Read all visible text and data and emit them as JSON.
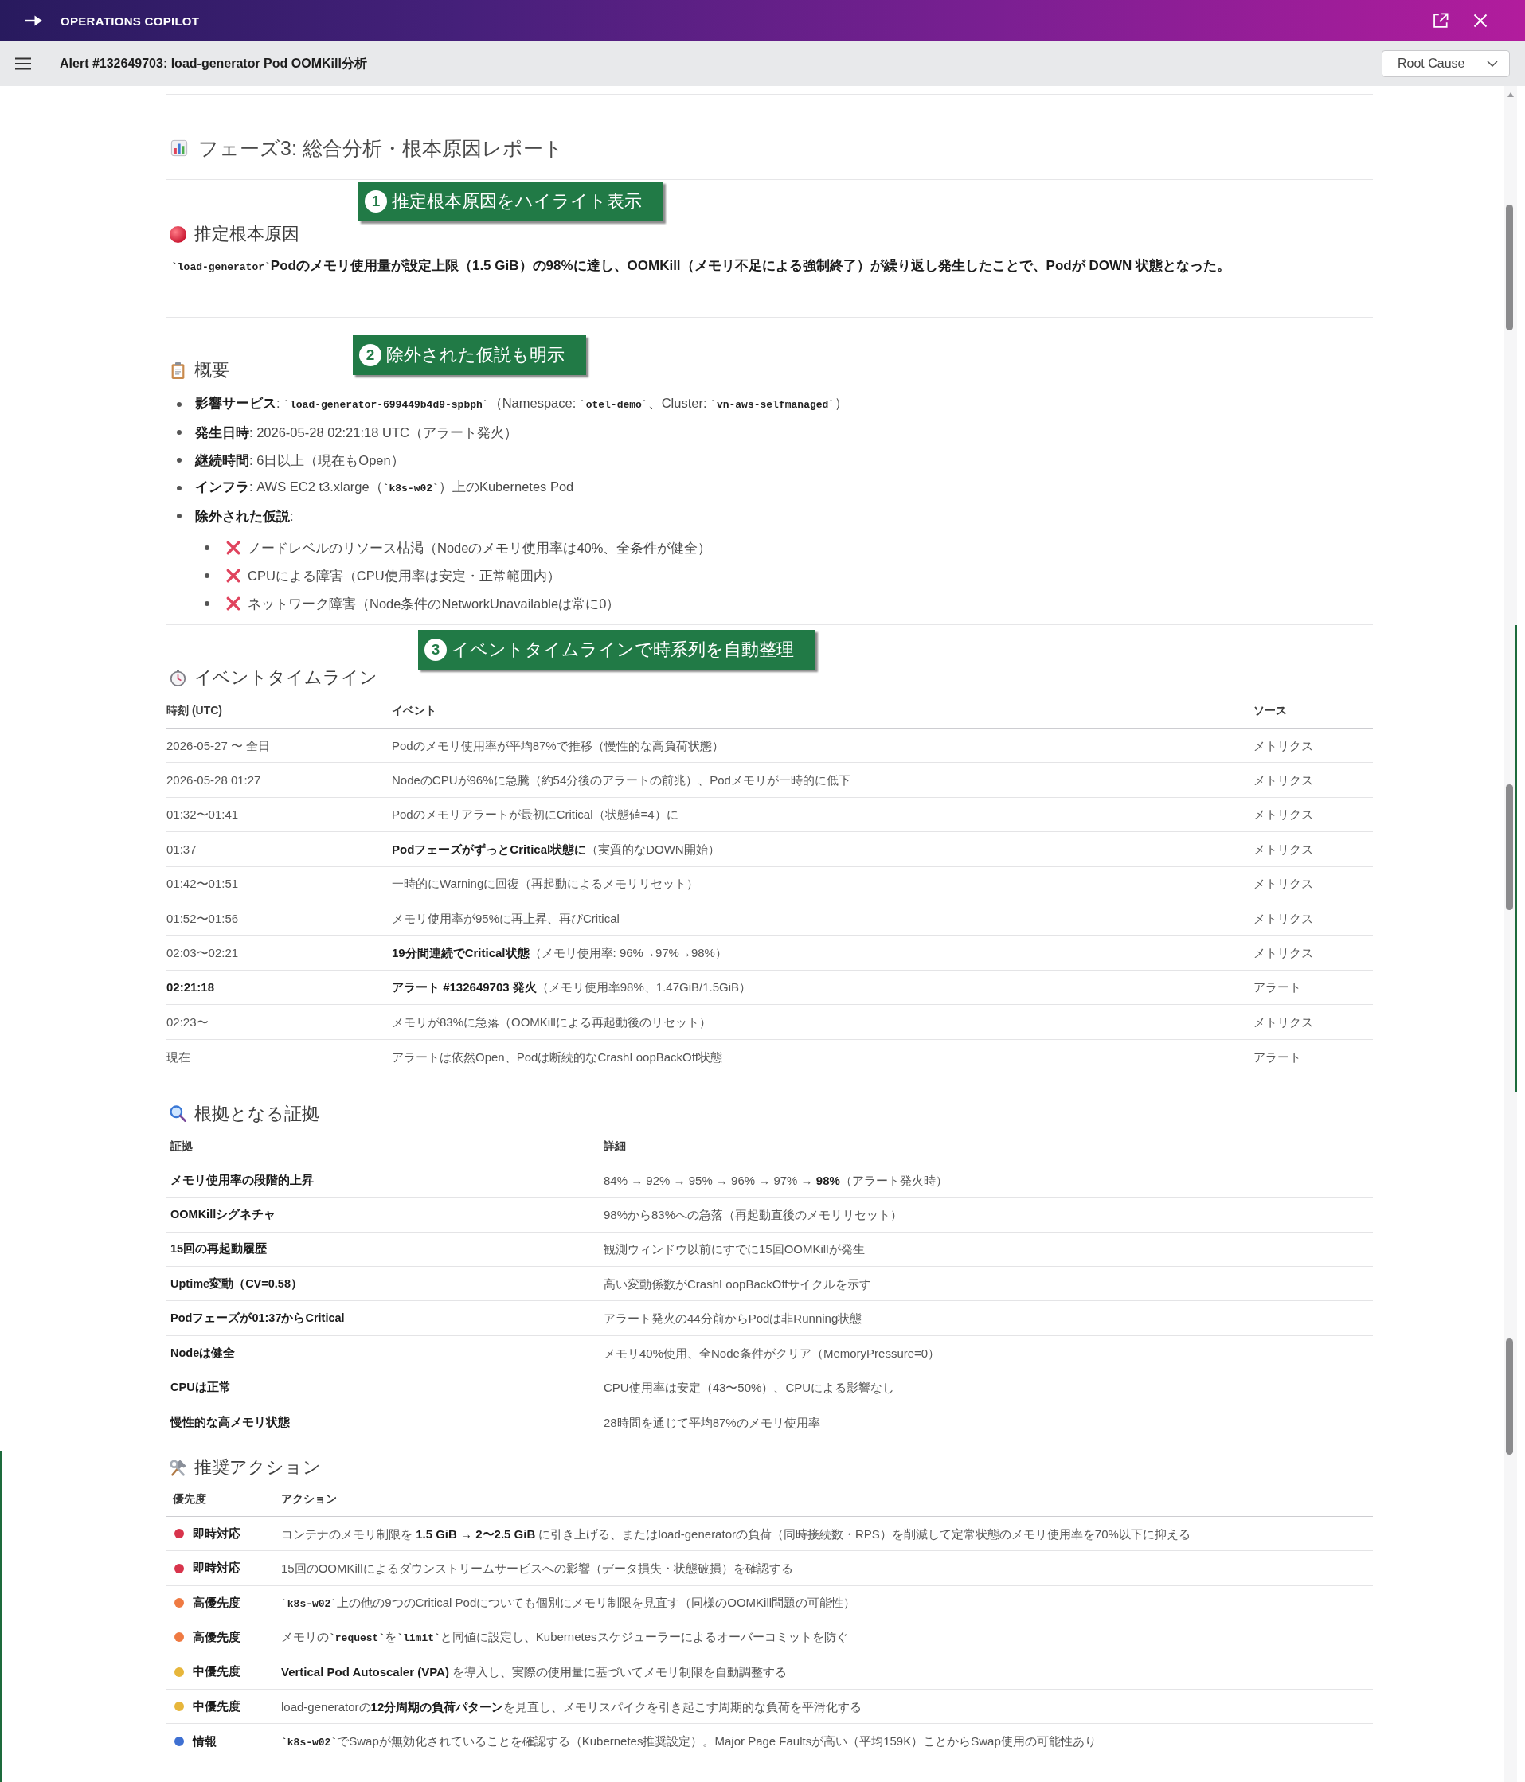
{
  "header": {
    "title": "OPERATIONS COPILOT"
  },
  "toolbar": {
    "title": "Alert #132649703: load-generator Pod OOMKill分析",
    "view_select": {
      "value": "Root Cause"
    }
  },
  "report": {
    "phase_title": "フェーズ3: 総合分析・根本原因レポート",
    "root_cause": {
      "callout": {
        "number": "1",
        "text": "推定根本原因をハイライト表示"
      },
      "heading": "推定根本原因",
      "statement": [
        {
          "kind": "code",
          "text": "`load-generator`"
        },
        {
          "kind": "text",
          "text": "Podのメモリ使用量が設定上限（1.5 GiB）の98%に達し、OOMKill（メモリ不足による強制終了）が繰り返し発生したことで、Podが DOWN 状態となった。"
        }
      ]
    },
    "overview": {
      "callout": {
        "number": "2",
        "text": "除外された仮説も明示"
      },
      "heading": "概要",
      "items": [
        {
          "text": [
            {
              "kind": "text",
              "text": "**影響サービス**: "
            },
            {
              "kind": "code",
              "text": "`load-generator-699449b4d9-spbph`"
            },
            {
              "kind": "text",
              "text": "（Namespace: "
            },
            {
              "kind": "code",
              "text": "`otel-demo`"
            },
            {
              "kind": "text",
              "text": "、Cluster: "
            },
            {
              "kind": "code",
              "text": "`vn-aws-selfmanaged`"
            },
            {
              "kind": "text",
              "text": "）"
            }
          ]
        },
        {
          "text": [
            {
              "kind": "text",
              "text": "**発生日時**: 2026-05-28 02:21:18 UTC（アラート発火）"
            }
          ]
        },
        {
          "text": [
            {
              "kind": "text",
              "text": "**継続時間**: 6日以上（現在もOpen）"
            }
          ]
        },
        {
          "text": [
            {
              "kind": "text",
              "text": "**インフラ**: AWS EC2 t3.xlarge（"
            },
            {
              "kind": "code",
              "text": "`k8s-w02`"
            },
            {
              "kind": "text",
              "text": "）上のKubernetes Pod"
            }
          ]
        },
        {
          "text": [
            {
              "kind": "text",
              "text": "**除外された仮説**:"
            }
          ],
          "children": [
            {
              "text": [
                {
                  "kind": "text",
                  "text": "ノードレベルのリソース枯渇（Nodeのメモリ使用率は40%、全条件が健全）"
                }
              ]
            },
            {
              "text": [
                {
                  "kind": "text",
                  "text": "CPUによる障害（CPU使用率は安定・正常範囲内）"
                }
              ]
            },
            {
              "text": [
                {
                  "kind": "text",
                  "text": "ネットワーク障害（Node条件のNetworkUnavailableは常に0）"
                }
              ]
            }
          ]
        }
      ]
    },
    "timeline": {
      "callout": {
        "number": "3",
        "text": "イベントタイムラインで時系列を自動整理"
      },
      "heading": "イベントタイムライン",
      "columns": [
        "時刻 (UTC)",
        "イベント",
        "ソース"
      ],
      "rows": [
        {
          "time": "2026-05-27 〜 全日",
          "event": "Podのメモリ使用率が平均87%で推移（慢性的な高負荷状態）",
          "source": "メトリクス",
          "highlighted": false
        },
        {
          "time": "2026-05-28 01:27",
          "event": "NodeのCPUが96%に急騰（約54分後のアラートの前兆）、Podメモリが一時的に低下",
          "source": "メトリクス",
          "highlighted": false
        },
        {
          "time": "01:32〜01:41",
          "event": "Podのメモリアラートが最初にCritical（状態値=4）に",
          "source": "メトリクス",
          "highlighted": false
        },
        {
          "time": "01:37",
          "event": "**PodフェーズがずっとCritical状態に**（実質的なDOWN開始）",
          "source": "メトリクス",
          "highlighted": false
        },
        {
          "time": "01:42〜01:51",
          "event": "一時的にWarningに回復（再起動によるメモリリセット）",
          "source": "メトリクス",
          "highlighted": false
        },
        {
          "time": "01:52〜01:56",
          "event": "メモリ使用率が95%に再上昇、再びCritical",
          "source": "メトリクス",
          "highlighted": false
        },
        {
          "time": "02:03〜02:21",
          "event": "**19分間連続でCritical状態**（メモリ使用率: 96%→97%→98%）",
          "source": "メトリクス",
          "highlighted": false
        },
        {
          "time": "02:21:18",
          "event": "**アラート #132649703 発火**（メモリ使用率98%、1.47GiB/1.5GiB）",
          "source": "アラート",
          "highlighted": true
        },
        {
          "time": "02:23〜",
          "event": "メモリが83%に急落（OOMKillによる再起動後のリセット）",
          "source": "メトリクス",
          "highlighted": false
        },
        {
          "time": "現在",
          "event": "アラートは依然Open、Podは断続的なCrashLoopBackOff状態",
          "source": "アラート",
          "highlighted": false
        }
      ]
    },
    "evidence": {
      "heading": "根拠となる証拠",
      "columns": [
        "証拠",
        "詳細"
      ],
      "rows": [
        {
          "evidence": "メモリ使用率の段階的上昇",
          "detail": "84% → 92% → 95% → 96% → 97% → **98%**（アラート発火時）"
        },
        {
          "evidence": "OOMKillシグネチャ",
          "detail": "98%から83%への急落（再起動直後のメモリリセット）"
        },
        {
          "evidence": "15回の再起動履歴",
          "detail": "観測ウィンドウ以前にすでに15回OOMKillが発生"
        },
        {
          "evidence": "Uptime変動（CV=0.58）",
          "detail": "高い変動係数がCrashLoopBackOffサイクルを示す"
        },
        {
          "evidence": "Podフェーズが01:37からCritical",
          "detail": "アラート発火の44分前からPodは非Running状態"
        },
        {
          "evidence": "Nodeは健全",
          "detail": "メモリ40%使用、全Node条件がクリア（MemoryPressure=0）"
        },
        {
          "evidence": "CPUは正常",
          "detail": "CPU使用率は安定（43〜50%）、CPUによる影響なし"
        },
        {
          "evidence": "慢性的な高メモリ状態",
          "detail": "28時間を通じて平均87%のメモリ使用率"
        }
      ]
    },
    "actions": {
      "heading": "推奨アクション",
      "columns": [
        "優先度",
        "アクション"
      ],
      "rows": [
        {
          "priority": "即時対応",
          "color": "#d8344c",
          "action": [
            {
              "kind": "text",
              "text": "コンテナのメモリ制限を **1.5 GiB → 2〜2.5 GiB** に引き上げる、またはload-generatorの負荷（同時接続数・RPS）を削減して定常状態のメモリ使用率を70%以下に抑える"
            }
          ]
        },
        {
          "priority": "即時対応",
          "color": "#d8344c",
          "action": [
            {
              "kind": "text",
              "text": "15回のOOMKillによるダウンストリームサービスへの影響（データ損失・状態破損）を確認する"
            }
          ]
        },
        {
          "priority": "高優先度",
          "color": "#ef7a42",
          "action": [
            {
              "kind": "code",
              "text": "`k8s-w02`"
            },
            {
              "kind": "text",
              "text": "上の他の9つのCritical Podについても個別にメモリ制限を見直す（同様のOOMKill問題の可能性）"
            }
          ]
        },
        {
          "priority": "高優先度",
          "color": "#ef7a42",
          "action": [
            {
              "kind": "text",
              "text": "メモリの"
            },
            {
              "kind": "code",
              "text": "`request`"
            },
            {
              "kind": "text",
              "text": "を"
            },
            {
              "kind": "code",
              "text": "`limit`"
            },
            {
              "kind": "text",
              "text": "と同値に設定し、Kubernetesスケジューラーによるオーバーコミットを防ぐ"
            }
          ]
        },
        {
          "priority": "中優先度",
          "color": "#e7b63b",
          "action": [
            {
              "kind": "text",
              "text": "**Vertical Pod Autoscaler (VPA)** を導入し、実際の使用量に基づいてメモリ制限を自動調整する"
            }
          ]
        },
        {
          "priority": "中優先度",
          "color": "#e7b63b",
          "action": [
            {
              "kind": "text",
              "text": "load-generatorの**12分周期の負荷パターン**を見直し、メモリスパイクを引き起こす周期的な負荷を平滑化する"
            }
          ]
        },
        {
          "priority": "情報",
          "color": "#3e70d2",
          "action": [
            {
              "kind": "code",
              "text": "`k8s-w02`"
            },
            {
              "kind": "text",
              "text": "でSwapが無効化されていることを確認する（Kubernetes推奨設定）。Major Page Faultsが高い（平均159K）ことからSwap使用の可能性あり"
            }
          ]
        }
      ]
    }
  }
}
